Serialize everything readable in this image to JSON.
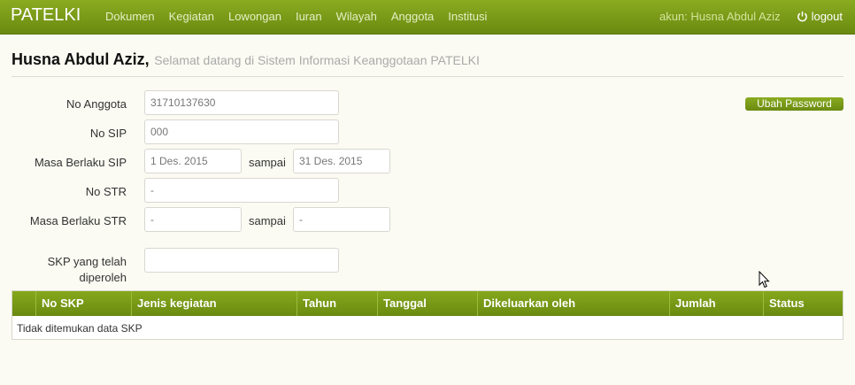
{
  "navbar": {
    "brand": "PATELKI",
    "menu": [
      "Dokumen",
      "Kegiatan",
      "Lowongan",
      "Iuran",
      "Wilayah",
      "Anggota",
      "Institusi"
    ],
    "account": "akun: Husna Abdul Aziz",
    "logout": "logout"
  },
  "heading": {
    "name": "Husna Abdul Aziz,",
    "welcome": "Selamat datang di Sistem Informasi Keanggotaan PATELKI"
  },
  "form": {
    "no_anggota_label": "No Anggota",
    "no_anggota_value": "31710137630",
    "no_sip_label": "No SIP",
    "no_sip_value": "000",
    "masa_sip_label": "Masa Berlaku SIP",
    "masa_sip_from": "1 Des. 2015",
    "masa_sip_to": "31 Des. 2015",
    "sampai": "sampai",
    "no_str_label": "No STR",
    "no_str_value": "-",
    "masa_str_label": "Masa Berlaku STR",
    "masa_str_from": "-",
    "masa_str_to": "-",
    "skp_label_1": "SKP yang telah",
    "skp_label_2": "diperoleh",
    "skp_value": ""
  },
  "buttons": {
    "ubah_password": "Ubah Password"
  },
  "table": {
    "headers": [
      "No SKP",
      "Jenis kegiatan",
      "Tahun",
      "Tanggal",
      "Dikeluarkan oleh",
      "Jumlah",
      "Status"
    ],
    "empty_text": "Tidak ditemukan data SKP"
  }
}
